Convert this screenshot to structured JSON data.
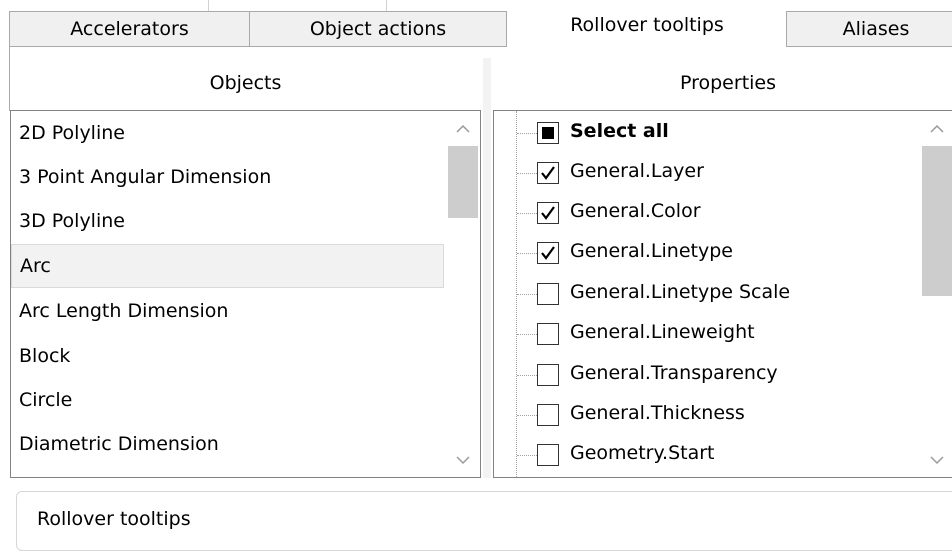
{
  "tabs": [
    {
      "label": "Accelerators",
      "active": false
    },
    {
      "label": "Object actions",
      "active": false
    },
    {
      "label": "Rollover tooltips",
      "active": true
    },
    {
      "label": "Aliases",
      "active": false
    }
  ],
  "objects": {
    "header": "Objects",
    "items": [
      "2D Polyline",
      "3 Point Angular Dimension",
      "3D Polyline",
      "Arc",
      "Arc Length Dimension",
      "Block",
      "Circle",
      "Diametric Dimension"
    ],
    "selected_index": 3
  },
  "properties": {
    "header": "Properties",
    "items": [
      {
        "label": "Select all",
        "state": "indeterminate",
        "bold": true
      },
      {
        "label": "General.Layer",
        "state": "checked"
      },
      {
        "label": "General.Color",
        "state": "checked"
      },
      {
        "label": "General.Linetype",
        "state": "checked"
      },
      {
        "label": "General.Linetype Scale",
        "state": "unchecked"
      },
      {
        "label": "General.Lineweight",
        "state": "unchecked"
      },
      {
        "label": "General.Transparency",
        "state": "unchecked"
      },
      {
        "label": "General.Thickness",
        "state": "unchecked"
      },
      {
        "label": "Geometry.Start",
        "state": "unchecked"
      }
    ]
  },
  "bottom": {
    "label": "Rollover tooltips"
  },
  "icons": {
    "scroll_up": "chevron-up-icon",
    "scroll_down": "chevron-down-icon",
    "check": "checkmark-icon"
  },
  "colors": {
    "tab_inactive_bg": "#f0f0f0",
    "selection_bg": "#f2f2f2",
    "scroll_thumb": "#cdcdcd",
    "border": "#828282"
  }
}
